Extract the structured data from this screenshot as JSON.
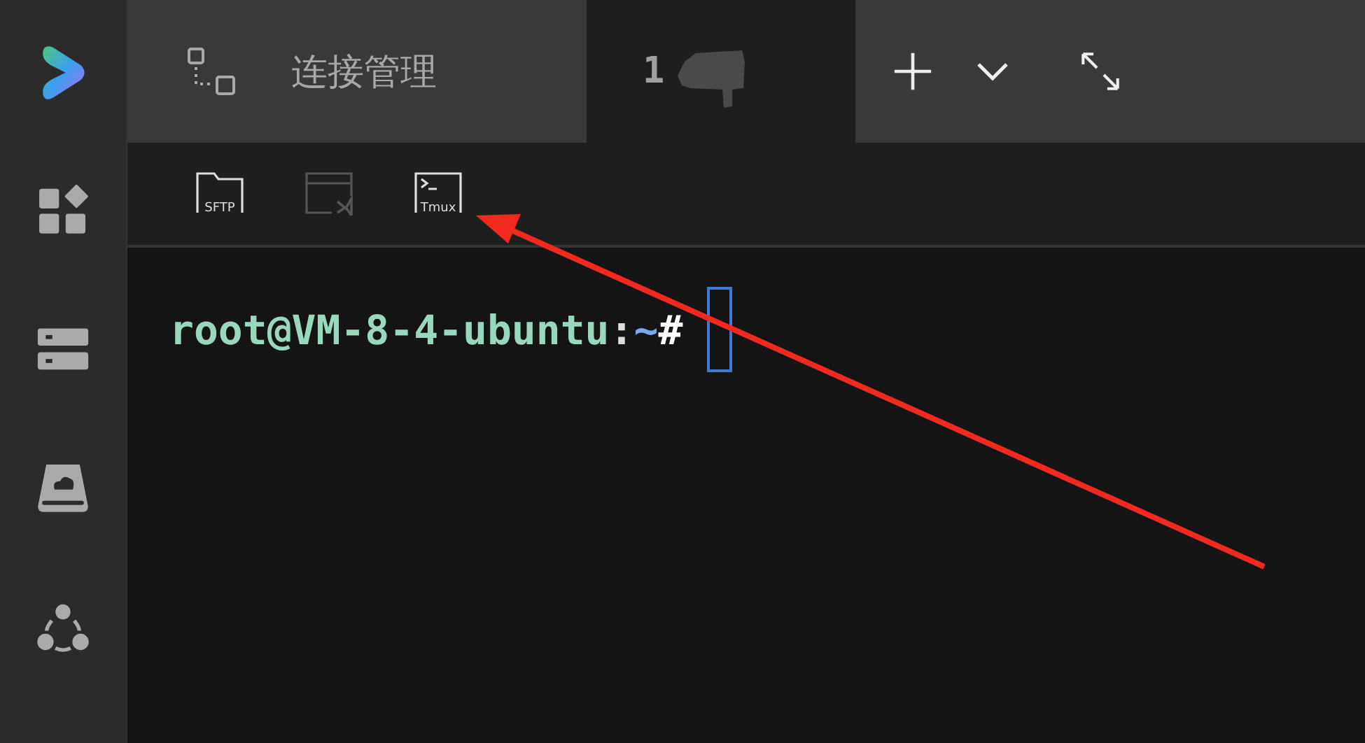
{
  "tabs": [
    {
      "kind": "manager",
      "label": "连接管理",
      "selected": false
    },
    {
      "kind": "session",
      "label": "1",
      "selected": true
    }
  ],
  "toolbar": [
    {
      "kind": "sftp",
      "label": "SFTP",
      "disabled": false
    },
    {
      "kind": "vscode",
      "disabled": true
    },
    {
      "kind": "tmux",
      "label": "Tmux",
      "disabled": false
    }
  ],
  "terminal": {
    "user_host": "root@VM-8-4-ubuntu",
    "separator": ":",
    "path": "~",
    "symbol": "#"
  }
}
